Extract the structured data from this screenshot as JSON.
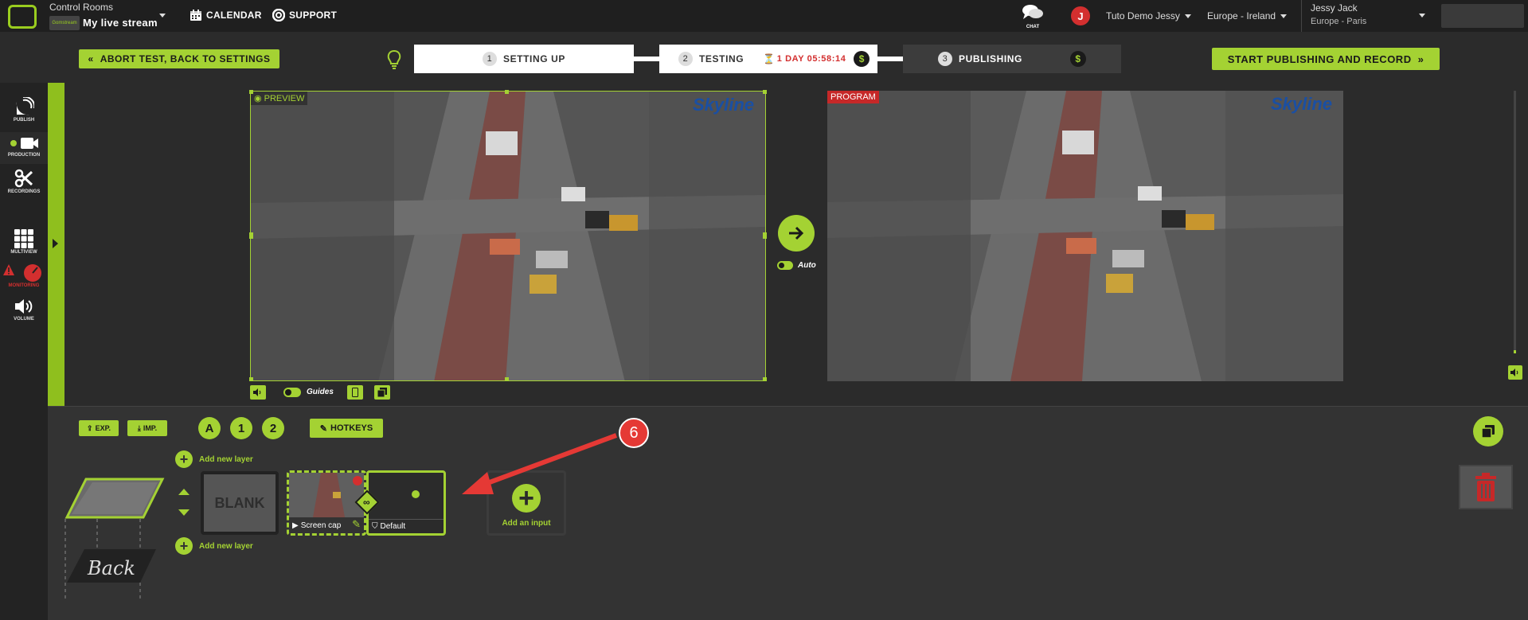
{
  "header": {
    "section": "Control Rooms",
    "stream_name": "My live stream",
    "calendar": "CALENDAR",
    "support": "SUPPORT",
    "chat": "CHAT",
    "user_initial": "J",
    "account": "Tuto Demo Jessy",
    "region": "Europe - Ireland",
    "user_name": "Jessy Jack",
    "timezone": "Europe - Paris",
    "brand_small": "Gomstream"
  },
  "stepbar": {
    "abort_label": "ABORT TEST, BACK TO SETTINGS",
    "steps": [
      {
        "num": "1",
        "label": "SETTING UP"
      },
      {
        "num": "2",
        "label": "TESTING",
        "timer": "1 DAY 05:58:14",
        "dollar": "$"
      },
      {
        "num": "3",
        "label": "PUBLISHING",
        "dollar": "$"
      }
    ],
    "start_label": "START PUBLISHING AND RECORD"
  },
  "sidebar": {
    "items": [
      "PUBLISH",
      "PRODUCTION",
      "RECORDINGS",
      "MULTIVIEW",
      "MONITORING",
      "VOLUME"
    ]
  },
  "preview": {
    "label": "PREVIEW",
    "brand": "Skyline",
    "guides": "Guides"
  },
  "program": {
    "label": "PROGRAM",
    "brand": "Skyline"
  },
  "transition": {
    "auto": "Auto"
  },
  "bottom": {
    "exp": "EXP.",
    "imp": "IMP.",
    "layer_buttons": [
      "A",
      "1",
      "2"
    ],
    "hotkeys": "HOTKEYS",
    "add_layer_top": "Add new layer",
    "add_layer_bottom": "Add new layer",
    "back": "Back",
    "blank": "BLANK",
    "input_name": "Screen cap",
    "overlay_name": "Default",
    "add_input": "Add an input",
    "annotation_number": "6"
  },
  "colors": {
    "accent": "#a4d233",
    "danger": "#d32f2f",
    "annotation": "#e53935"
  }
}
